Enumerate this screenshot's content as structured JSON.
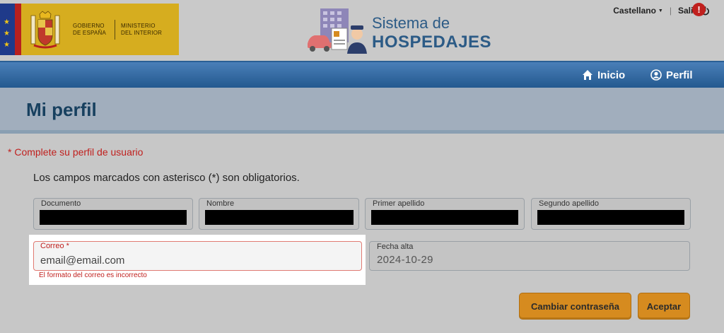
{
  "header": {
    "gov_line1": "GOBIERNO",
    "gov_line2": "DE ESPAÑA",
    "ministry_line1": "MINISTERIO",
    "ministry_line2": "DEL INTERIOR",
    "system_title_1": "Sistema de",
    "system_title_2": "HOSPEDAJES",
    "language": "Castellano",
    "separator": "|",
    "logout": "Salir"
  },
  "nav": {
    "home": "Inicio",
    "profile": "Perfil",
    "alert_badge": "!"
  },
  "page": {
    "title": "Mi perfil",
    "notice": "* Complete su perfil de usuario",
    "required_note": "Los campos marcados con asterisco (*) son obligatorios."
  },
  "form": {
    "documento_label": "Documento",
    "nombre_label": "Nombre",
    "primer_apellido_label": "Primer apellido",
    "segundo_apellido_label": "Segundo apellido",
    "correo_label": "Correo *",
    "correo_value": "email@email.com",
    "correo_error": "El formato del correo es incorrecto",
    "fecha_alta_label": "Fecha alta",
    "fecha_alta_value": "2024-10-29"
  },
  "buttons": {
    "change_password": "Cambiar contraseña",
    "accept": "Aceptar"
  },
  "colors": {
    "nav_blue": "#23598f",
    "title_band": "#a1aebd",
    "button_orange": "#d68b1f",
    "error_red": "#c0201e",
    "brand_yellow": "#d6ad1f"
  },
  "icons": [
    "power-icon",
    "home-icon",
    "user-circle-icon",
    "alert-badge",
    "coat-of-arms-icon",
    "hospedajes-logo-icon"
  ]
}
